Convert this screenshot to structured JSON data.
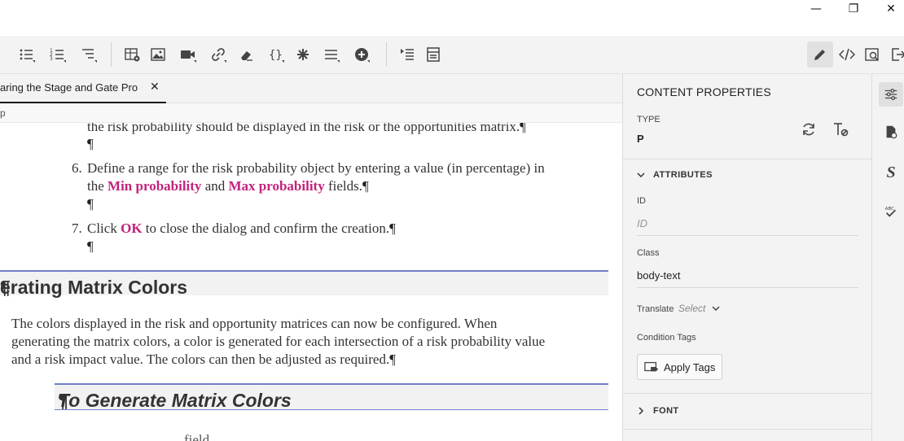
{
  "window": {
    "minimize_glyph": "—",
    "restore_glyph": "❐",
    "close_glyph": "✕"
  },
  "toolbar": {
    "icons": [
      "bulleted-list-icon",
      "numbered-list-icon",
      "multilevel-list-icon",
      "insert-table-icon",
      "insert-image-icon",
      "insert-video-icon",
      "insert-link-icon",
      "eraser-icon",
      "code-block-icon",
      "special-element-icon",
      "horizontal-rule-icon",
      "insert-plus-icon",
      "indent-list-icon",
      "block-view-icon",
      "edit-pencil-icon",
      "source-code-icon",
      "preview-icon",
      "export-icon"
    ]
  },
  "tab": {
    "label": "aring the Stage and Gate Pro...",
    "close_glyph": "✕"
  },
  "breadcrumb": "p",
  "document": {
    "line0": "the risk probability should be displayed in the risk or the opportunities matrix.",
    "pilcrow": "¶",
    "item6_num": "6.",
    "item6_line1": "Define a range for the risk probability object by entering a value (in percentage) in",
    "item6_line2_a": "the ",
    "item6_min": "Min probability",
    "item6_and": " and ",
    "item6_max": "Max probability",
    "item6_end": " fields.",
    "item7_num": "7.",
    "item7_a": "Click ",
    "item7_ok": "OK",
    "item7_end": " to close the dialog and confirm the creation.",
    "heading": "erating Matrix Colors",
    "para_line1": "The colors displayed in the risk and opportunity matrices can now be configured. When",
    "para_line2": "generating the matrix colors, a color is generated for each intersection of a risk probability value",
    "para_line3": "and a risk impact value. The colors can then be adjusted as required.",
    "subheading": "To Generate Matrix Colors",
    "partial_bottom": "... ... ... ... ... ... ... field"
  },
  "properties": {
    "title": "CONTENT PROPERTIES",
    "type_label": "TYPE",
    "type_value": "P",
    "attributes_label": "ATTRIBUTES",
    "id_label": "ID",
    "id_placeholder": "ID",
    "class_label": "Class",
    "class_value": "body-text",
    "translate_label": "Translate",
    "translate_value": "Select",
    "condition_tags_label": "Condition Tags",
    "apply_tags_label": "Apply Tags",
    "font_label": "FONT"
  },
  "rail": {
    "icons": [
      "properties-sliders-icon",
      "file-settings-icon",
      "style-s-icon",
      "spell-check-icon"
    ],
    "style_glyph": "S",
    "spell_glyph": "ABC"
  },
  "colors": {
    "accent_magenta": "#c1237c",
    "heading_border": "#6f7fc8"
  }
}
